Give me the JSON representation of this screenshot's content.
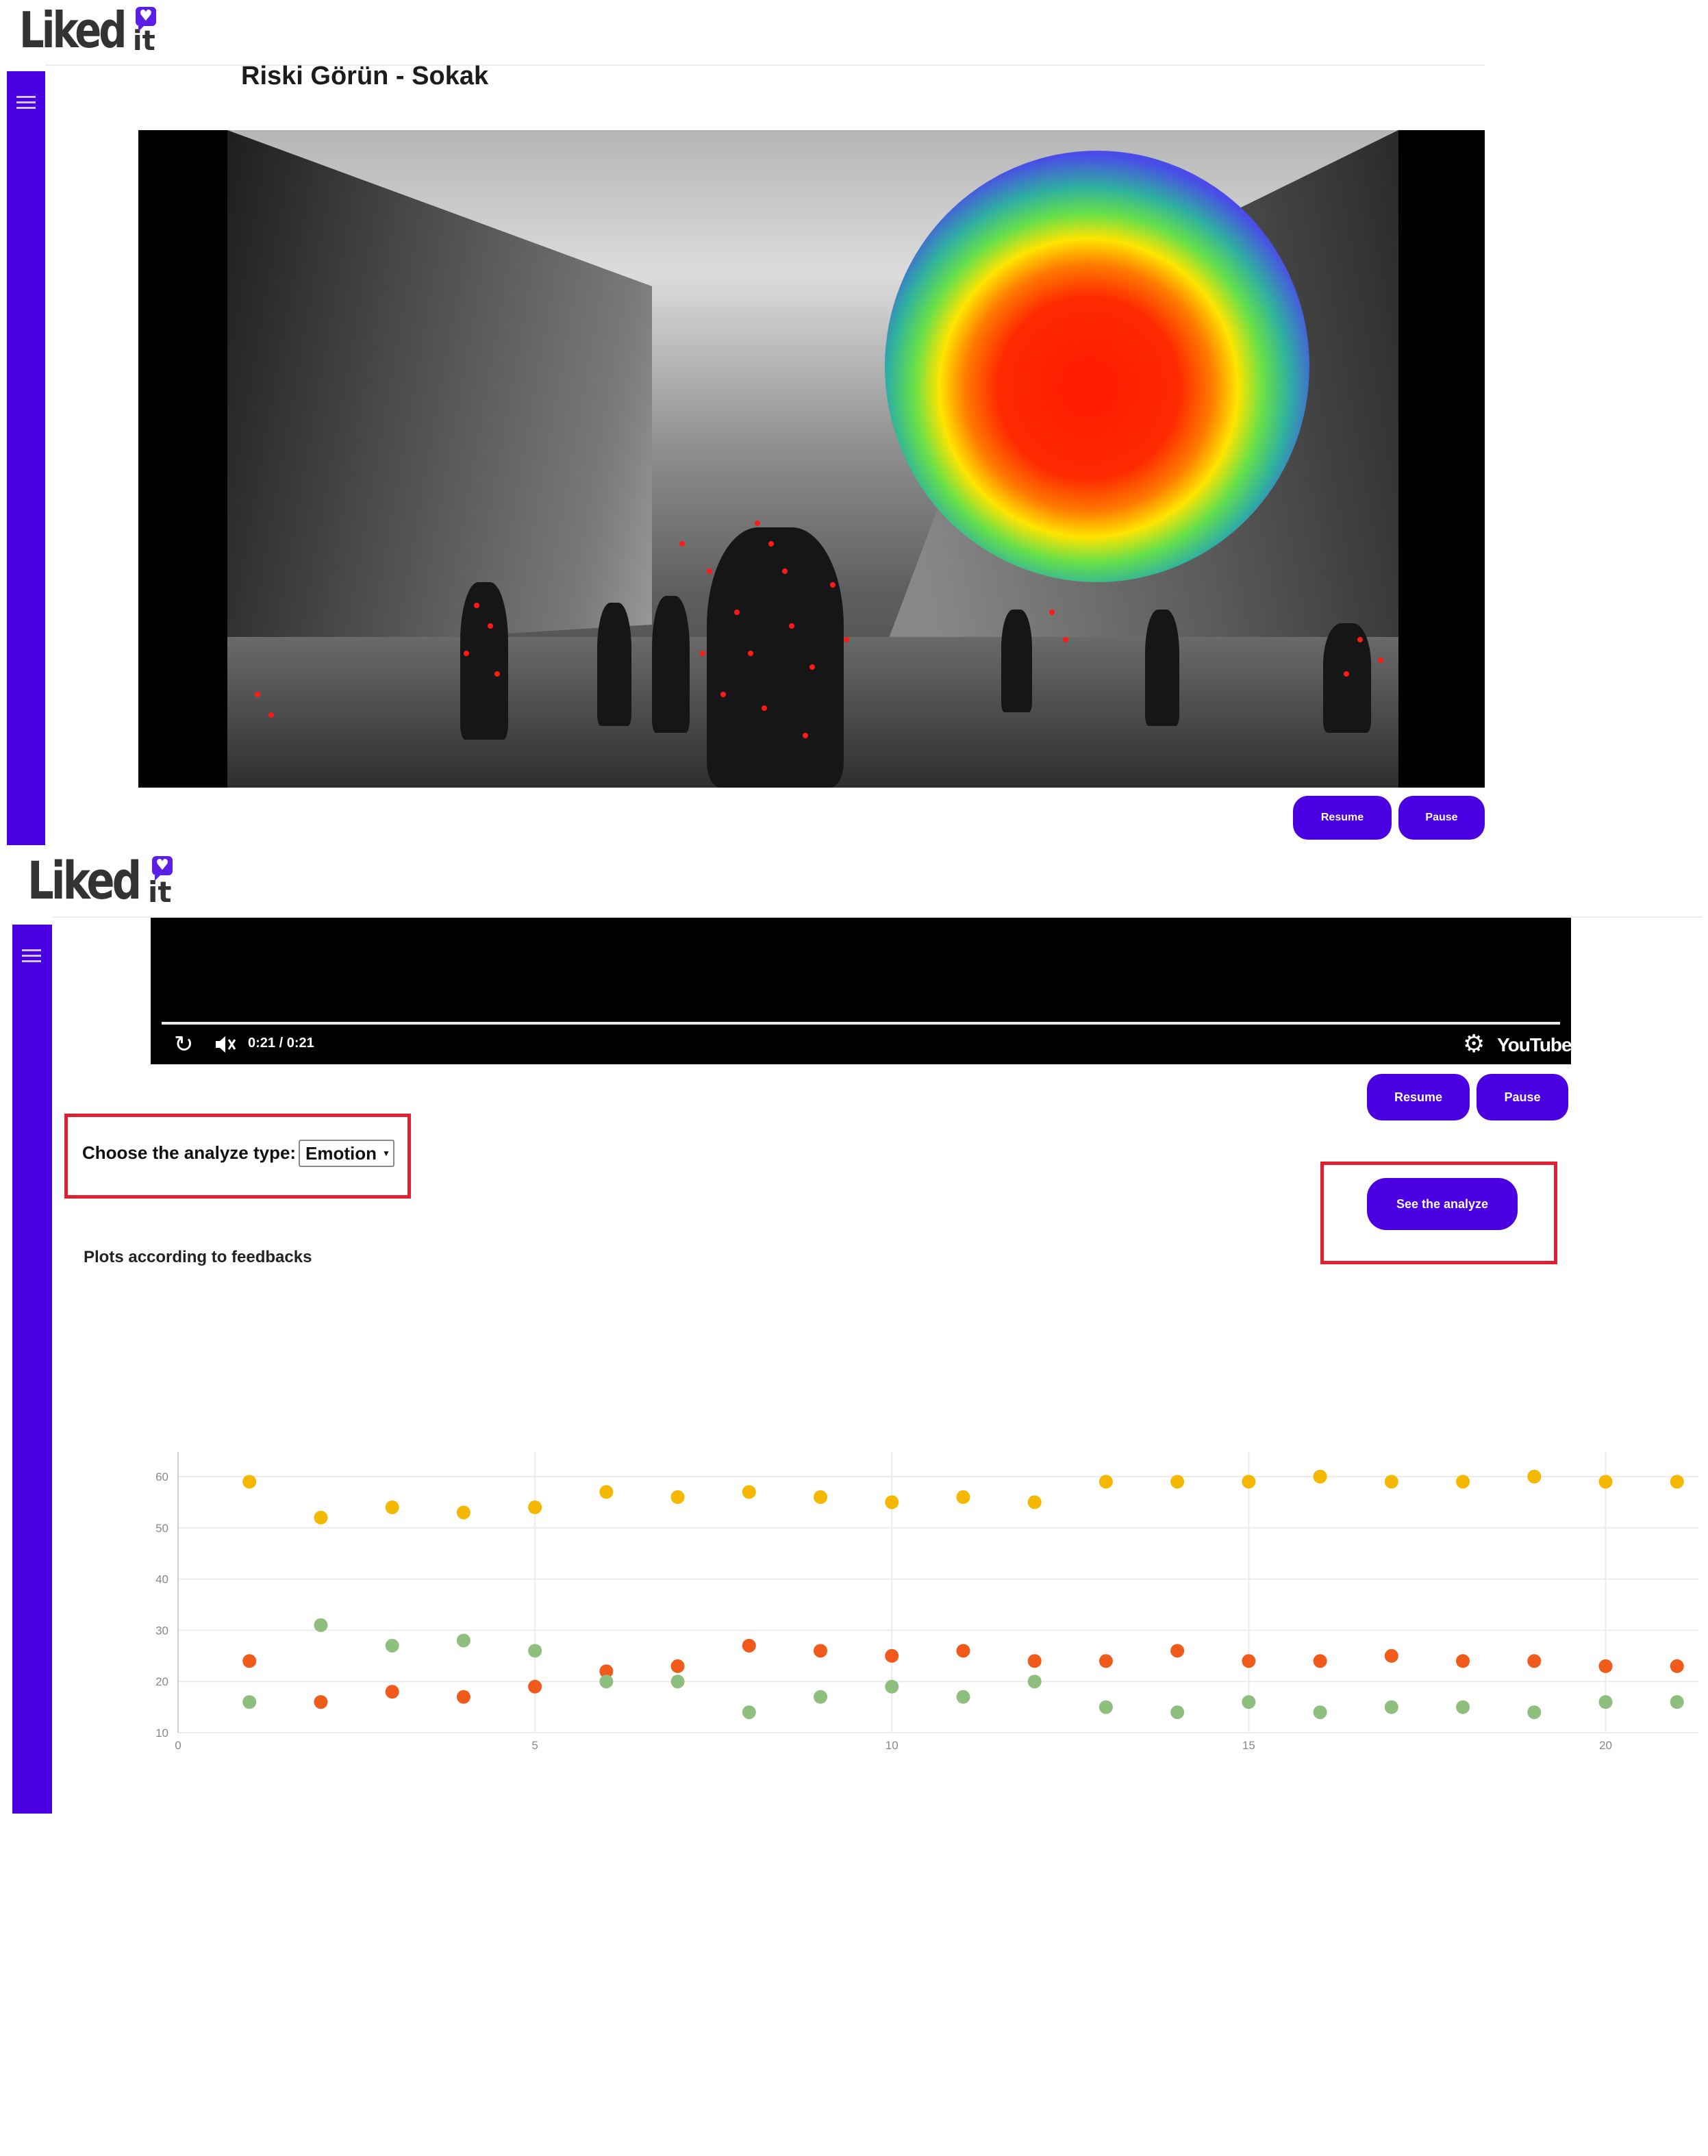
{
  "brand": {
    "name": "Liked",
    "suffix": "it",
    "badge_icon": "heart-icon",
    "accent_color": "#4a00e0"
  },
  "top": {
    "page_title": "Riski Görün - Sokak",
    "resume_label": "Resume",
    "pause_label": "Pause"
  },
  "bottom": {
    "player": {
      "time": "0:21 / 0:21",
      "brand": "YouTube",
      "progress": 1.0
    },
    "resume_label": "Resume",
    "pause_label": "Pause",
    "analyze_type_label": "Choose the analyze type:",
    "analyze_type_value": "Emotion",
    "see_analyze_label": "See the analyze",
    "plots_heading": "Plots according to feedbacks"
  },
  "chart_data": {
    "type": "scatter",
    "xlim": [
      0,
      21.3
    ],
    "ylim": [
      10,
      60
    ],
    "x_ticks": [
      0,
      5,
      10,
      15,
      20
    ],
    "y_ticks": [
      10,
      20,
      30,
      40,
      50,
      60
    ],
    "grid": true,
    "series": [
      {
        "color": "#f5b800",
        "points": [
          [
            1,
            59
          ],
          [
            2,
            52
          ],
          [
            3,
            54
          ],
          [
            4,
            53
          ],
          [
            5,
            54
          ],
          [
            6,
            57
          ],
          [
            7,
            56
          ],
          [
            8,
            57
          ],
          [
            9,
            56
          ],
          [
            10,
            55
          ],
          [
            11,
            56
          ],
          [
            12,
            55
          ],
          [
            13,
            59
          ],
          [
            14,
            59
          ],
          [
            15,
            59
          ],
          [
            16,
            60
          ],
          [
            17,
            59
          ],
          [
            18,
            59
          ],
          [
            19,
            60
          ],
          [
            20,
            59
          ],
          [
            21,
            59
          ]
        ]
      },
      {
        "color": "#f05a1a",
        "points": [
          [
            1,
            24
          ],
          [
            2,
            16
          ],
          [
            3,
            18
          ],
          [
            4,
            17
          ],
          [
            5,
            19
          ],
          [
            6,
            22
          ],
          [
            7,
            23
          ],
          [
            8,
            27
          ],
          [
            9,
            26
          ],
          [
            10,
            25
          ],
          [
            11,
            26
          ],
          [
            12,
            24
          ],
          [
            13,
            24
          ],
          [
            14,
            26
          ],
          [
            15,
            24
          ],
          [
            16,
            24
          ],
          [
            17,
            25
          ],
          [
            18,
            24
          ],
          [
            19,
            24
          ],
          [
            20,
            23
          ],
          [
            21,
            23
          ]
        ]
      },
      {
        "color": "#8fbf7f",
        "points": [
          [
            1,
            16
          ],
          [
            2,
            31
          ],
          [
            3,
            27
          ],
          [
            4,
            28
          ],
          [
            5,
            26
          ],
          [
            6,
            20
          ],
          [
            7,
            20
          ],
          [
            8,
            14
          ],
          [
            9,
            17
          ],
          [
            10,
            19
          ],
          [
            11,
            17
          ],
          [
            12,
            20
          ],
          [
            13,
            15
          ],
          [
            14,
            14
          ],
          [
            15,
            16
          ],
          [
            16,
            14
          ],
          [
            17,
            15
          ],
          [
            18,
            15
          ],
          [
            19,
            14
          ],
          [
            20,
            16
          ],
          [
            21,
            16
          ]
        ]
      }
    ]
  }
}
